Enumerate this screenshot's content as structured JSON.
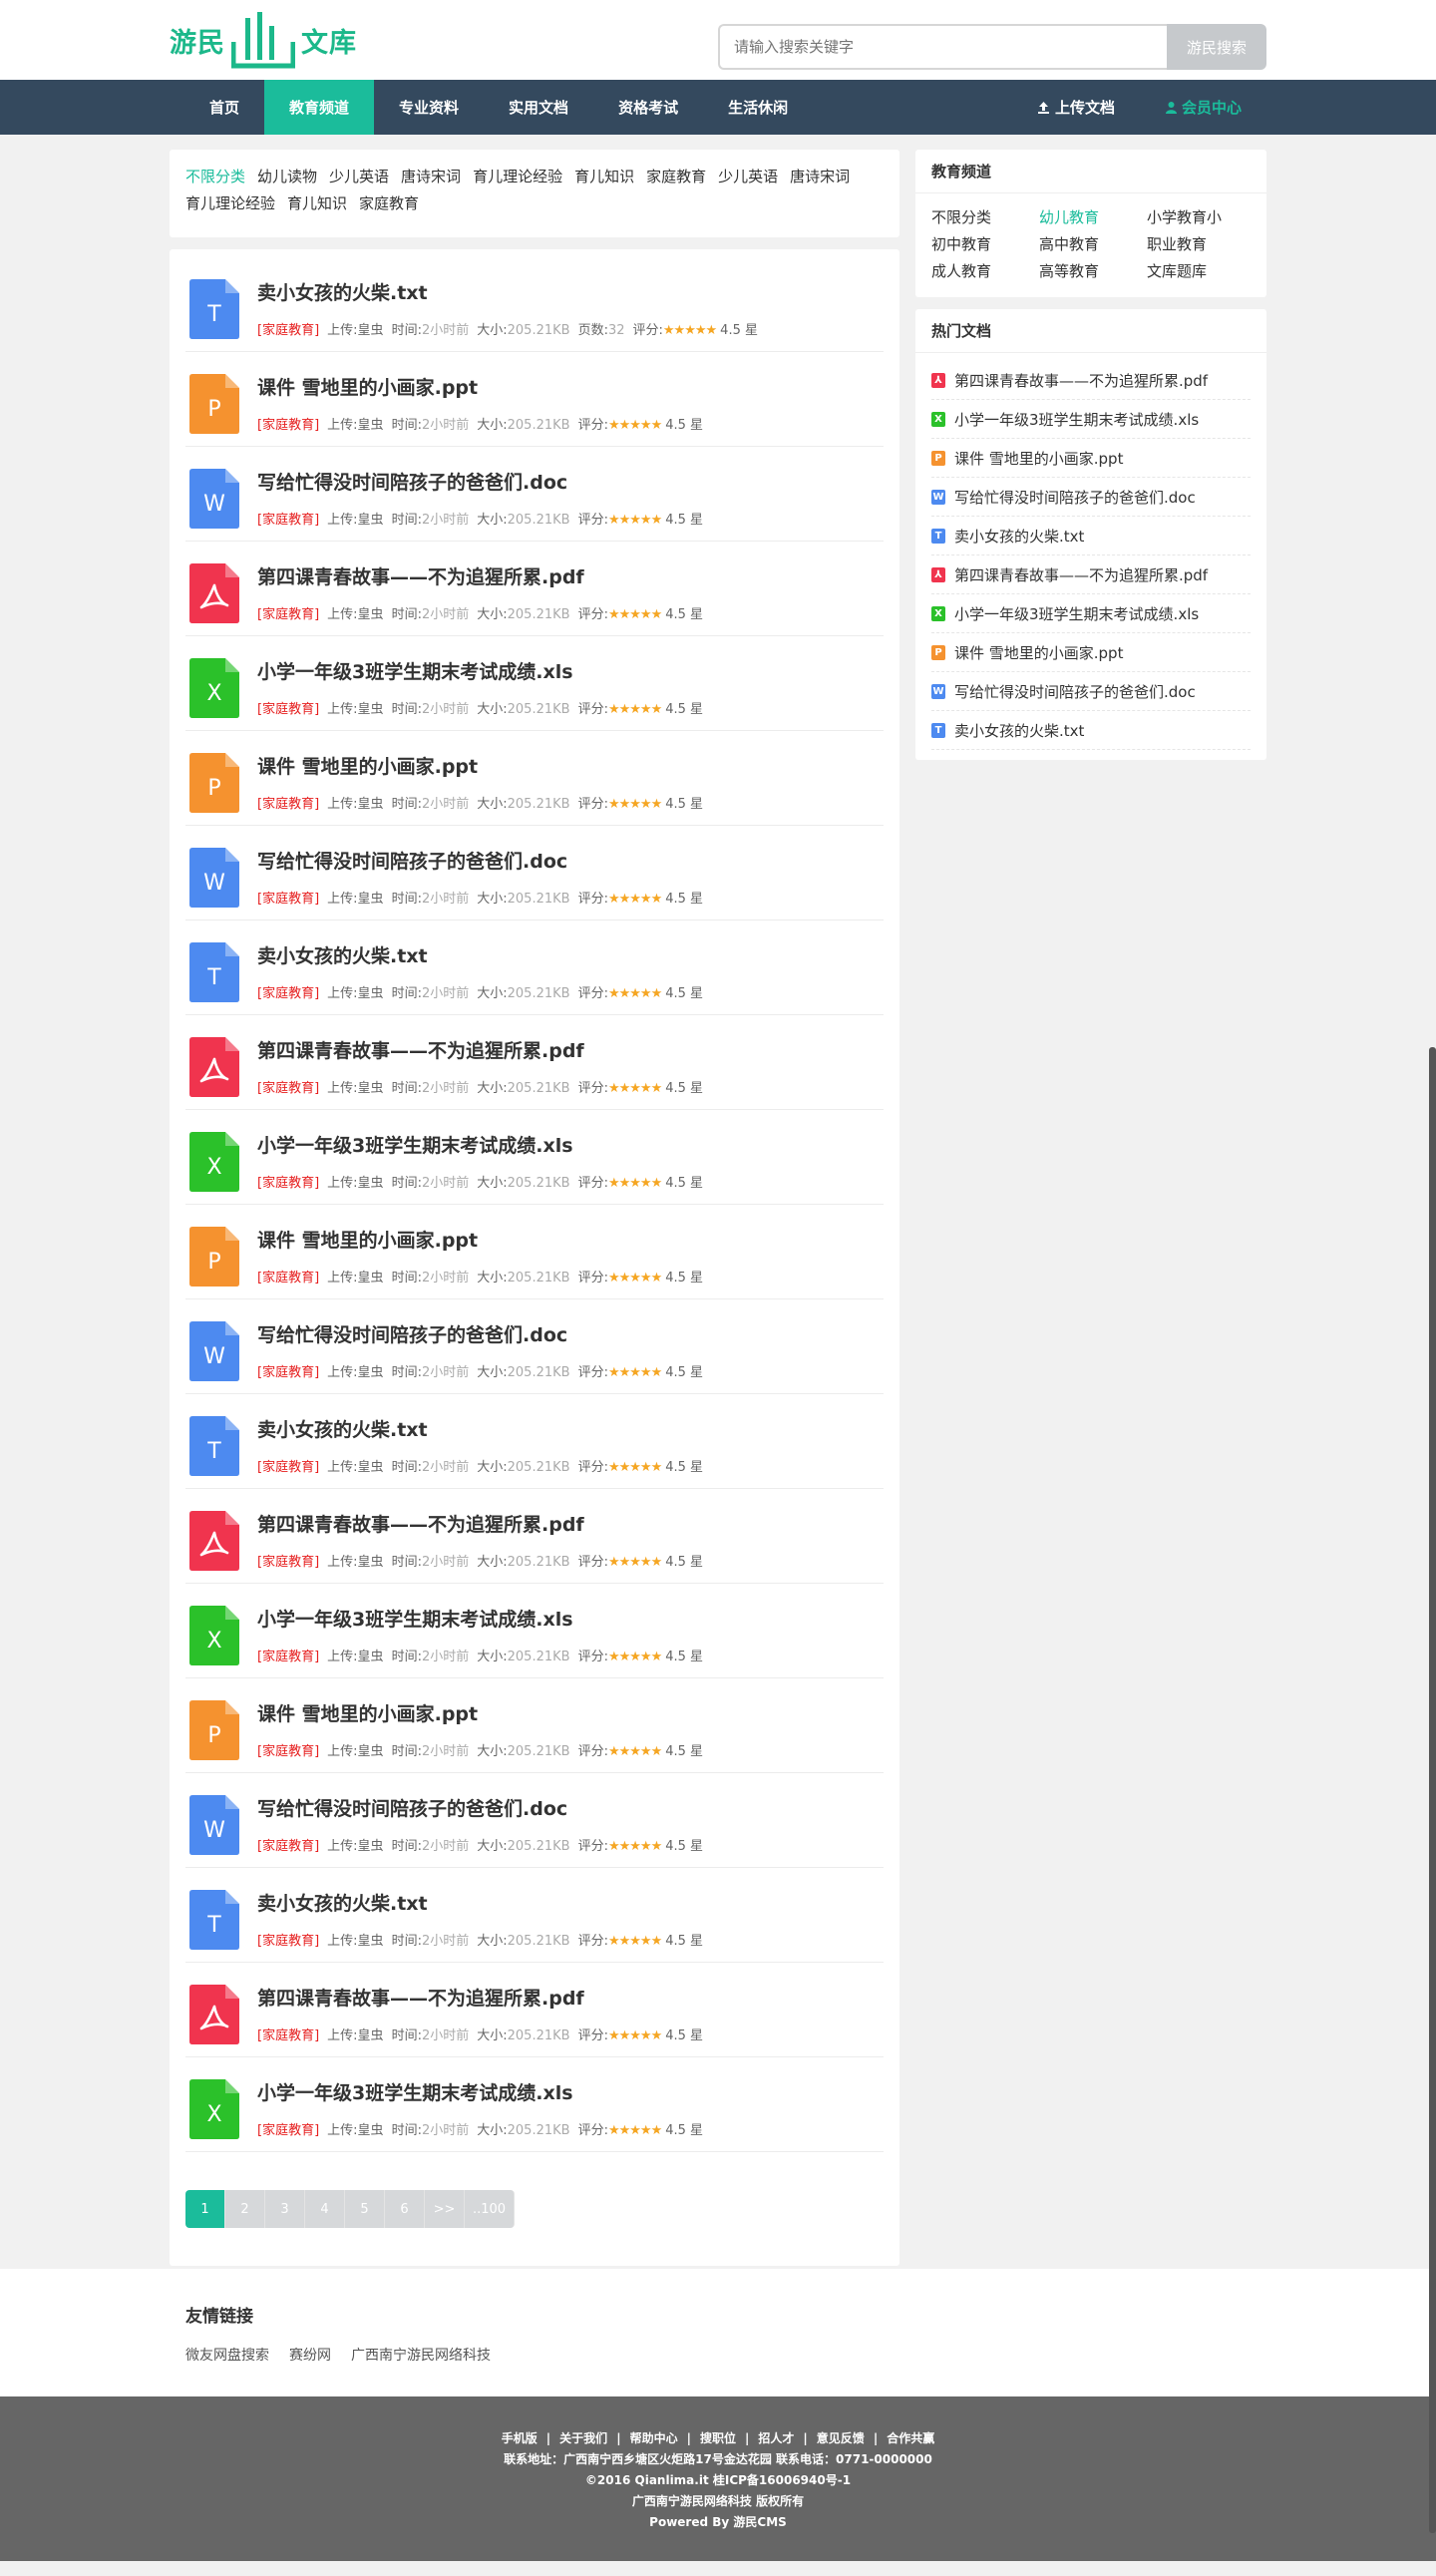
{
  "site": {
    "logo_left": "游民",
    "logo_right": "文库"
  },
  "search": {
    "placeholder": "请输入搜索关键字",
    "button": "游民搜索"
  },
  "nav": {
    "items": [
      "首页",
      "教育频道",
      "专业资料",
      "实用文档",
      "资格考试",
      "生活休闲"
    ],
    "active_index": 1,
    "upload": "上传文档",
    "member": "会员中心"
  },
  "categories": {
    "items": [
      "不限分类",
      "幼儿读物",
      "少儿英语",
      "唐诗宋词",
      "育儿理论经验",
      "育儿知识",
      "家庭教育",
      "少儿英语",
      "唐诗宋词",
      "育儿理论经验",
      "育儿知识",
      "家庭教育"
    ],
    "active_index": 0
  },
  "doc_meta": {
    "tag": "[家庭教育]",
    "uploader_label": "上传:",
    "uploader": "皇虫",
    "time_label": "时间:",
    "time": "2小时前",
    "size_label": "大小:",
    "size": "205.21KB",
    "pages_label": "页数:",
    "pages": "32",
    "score_label": "评分:",
    "stars": "★★★★★",
    "score": "4.5 星"
  },
  "doc_types": {
    "txt": {
      "letter": "T",
      "color": "#4d8af0"
    },
    "ppt": {
      "letter": "P",
      "color": "#f5922f"
    },
    "doc": {
      "letter": "W",
      "color": "#4d8af0"
    },
    "pdf": {
      "letter": "pdf",
      "color": "#f0344e"
    },
    "xls": {
      "letter": "X",
      "color": "#2bc12a"
    }
  },
  "documents": [
    {
      "title": "卖小女孩的火柴.txt",
      "type": "txt",
      "show_pages": true
    },
    {
      "title": "课件 雪地里的小画家.ppt",
      "type": "ppt"
    },
    {
      "title": "写给忙得没时间陪孩子的爸爸们.doc",
      "type": "doc"
    },
    {
      "title": "第四课青春故事——不为追猩所累.pdf",
      "type": "pdf"
    },
    {
      "title": "小学一年级3班学生期末考试成绩.xls",
      "type": "xls"
    },
    {
      "title": "课件 雪地里的小画家.ppt",
      "type": "ppt"
    },
    {
      "title": "写给忙得没时间陪孩子的爸爸们.doc",
      "type": "doc"
    },
    {
      "title": "卖小女孩的火柴.txt",
      "type": "txt"
    },
    {
      "title": "第四课青春故事——不为追猩所累.pdf",
      "type": "pdf"
    },
    {
      "title": "小学一年级3班学生期末考试成绩.xls",
      "type": "xls"
    },
    {
      "title": "课件 雪地里的小画家.ppt",
      "type": "ppt"
    },
    {
      "title": "写给忙得没时间陪孩子的爸爸们.doc",
      "type": "doc"
    },
    {
      "title": "卖小女孩的火柴.txt",
      "type": "txt"
    },
    {
      "title": "第四课青春故事——不为追猩所累.pdf",
      "type": "pdf"
    },
    {
      "title": "小学一年级3班学生期末考试成绩.xls",
      "type": "xls"
    },
    {
      "title": "课件 雪地里的小画家.ppt",
      "type": "ppt"
    },
    {
      "title": "写给忙得没时间陪孩子的爸爸们.doc",
      "type": "doc"
    },
    {
      "title": "卖小女孩的火柴.txt",
      "type": "txt"
    },
    {
      "title": "第四课青春故事——不为追猩所累.pdf",
      "type": "pdf"
    },
    {
      "title": "小学一年级3班学生期末考试成绩.xls",
      "type": "xls"
    }
  ],
  "pager": {
    "pages": [
      "1",
      "2",
      "3",
      "4",
      "5",
      "6",
      ">>",
      "..100"
    ],
    "current": "1"
  },
  "channels": {
    "title": "教育频道",
    "items": [
      "不限分类",
      "幼儿教育",
      "小学教育小",
      "初中教育",
      "高中教育",
      "职业教育",
      "成人教育",
      "高等教育",
      "文库题库"
    ],
    "active_index": 1
  },
  "hot": {
    "title": "热门文档",
    "items": [
      {
        "title": "第四课青春故事——不为追猩所累.pdf",
        "type": "pdf"
      },
      {
        "title": "小学一年级3班学生期末考试成绩.xls",
        "type": "xls"
      },
      {
        "title": "课件 雪地里的小画家.ppt",
        "type": "ppt"
      },
      {
        "title": "写给忙得没时间陪孩子的爸爸们.doc",
        "type": "doc"
      },
      {
        "title": "卖小女孩的火柴.txt",
        "type": "txt"
      },
      {
        "title": "第四课青春故事——不为追猩所累.pdf",
        "type": "pdf"
      },
      {
        "title": "小学一年级3班学生期末考试成绩.xls",
        "type": "xls"
      },
      {
        "title": "课件 雪地里的小画家.ppt",
        "type": "ppt"
      },
      {
        "title": "写给忙得没时间陪孩子的爸爸们.doc",
        "type": "doc"
      },
      {
        "title": "卖小女孩的火柴.txt",
        "type": "txt"
      }
    ]
  },
  "friend_links": {
    "title": "友情链接",
    "items": [
      "微友网盘搜索",
      "赛纷网",
      "广西南宁游民网络科技"
    ]
  },
  "footer": {
    "links": [
      "手机版",
      "关于我们",
      "帮助中心",
      "搜职位",
      "招人才",
      "意见反馈",
      "合作共赢"
    ],
    "separator": "|",
    "address": "联系地址：广西南宁西乡塘区火炬路17号金达花园 联系电话：0771-0000000",
    "icp": "©2016 Qianlima.it 桂ICP备16006940号-1",
    "copyright": "广西南宁游民网络科技 版权所有",
    "powered": "Powered By 游民CMS"
  },
  "icons": {
    "upload": "upload-icon",
    "member": "user-icon"
  }
}
